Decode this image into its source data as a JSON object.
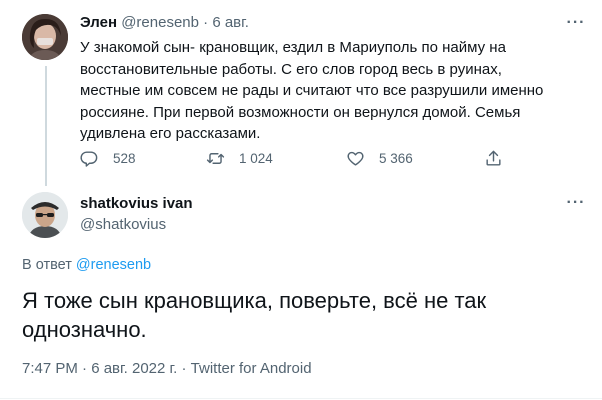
{
  "parent_tweet": {
    "author_name": "Элен",
    "author_handle": "@renesenb",
    "separator": "·",
    "date": "6 авг.",
    "text": "У знакомой сын- крановщик, ездил в Мариуполь по найму на восстановительные работы. С его слов город весь в руинах, местные им совсем не рады и считают что все разрушили именно россияне. При первой возможности он вернулся домой. Семья удивлена его рассказами.",
    "more_icon": "more-horizontal-icon",
    "actions": {
      "replies": "528",
      "retweets": "1 024",
      "likes": "5 366"
    }
  },
  "main_tweet": {
    "author_name": "shatkovius ivan",
    "author_handle": "@shatkovius",
    "reply_prefix": "В ответ ",
    "reply_to_handle": "@renesenb",
    "text": "Я тоже сын крановщика, поверьте, всё не так однозначно.",
    "meta": "7:47 PM · 6 авг. 2022 г. · Twitter for Android"
  },
  "colors": {
    "text": "#0f1419",
    "secondary": "#536471",
    "link": "#1d9bf0",
    "thread_line": "#cfd9de"
  }
}
